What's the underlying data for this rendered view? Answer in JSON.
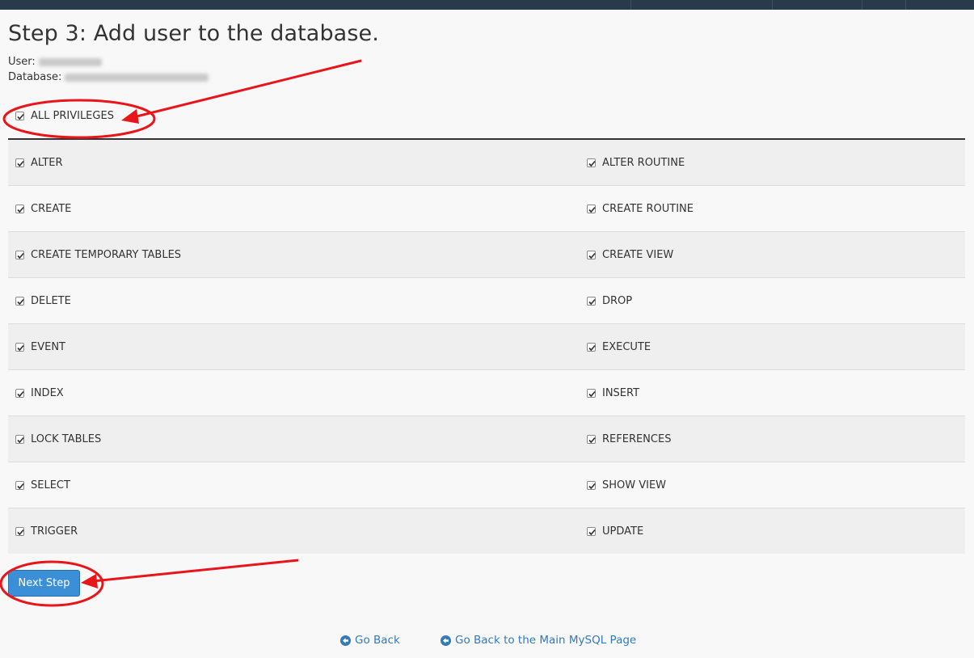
{
  "header": {
    "title": "Step 3: Add user to the database."
  },
  "meta": {
    "user_label": "User:",
    "database_label": "Database:"
  },
  "all_privileges": {
    "label": "ALL PRIVILEGES",
    "checked": true
  },
  "privileges": [
    {
      "left": "ALTER",
      "right": "ALTER ROUTINE"
    },
    {
      "left": "CREATE",
      "right": "CREATE ROUTINE"
    },
    {
      "left": "CREATE TEMPORARY TABLES",
      "right": "CREATE VIEW"
    },
    {
      "left": "DELETE",
      "right": "DROP"
    },
    {
      "left": "EVENT",
      "right": "EXECUTE"
    },
    {
      "left": "INDEX",
      "right": "INSERT"
    },
    {
      "left": "LOCK TABLES",
      "right": "REFERENCES"
    },
    {
      "left": "SELECT",
      "right": "SHOW VIEW"
    },
    {
      "left": "TRIGGER",
      "right": "UPDATE"
    }
  ],
  "actions": {
    "next_step": "Next Step"
  },
  "footer": {
    "go_back": "Go Back",
    "go_back_main": "Go Back to the Main MySQL Page"
  },
  "colors": {
    "topbar": "#293a4a",
    "button": "#3b8fd6",
    "link": "#337ab7",
    "annotation": "#e8151b"
  }
}
